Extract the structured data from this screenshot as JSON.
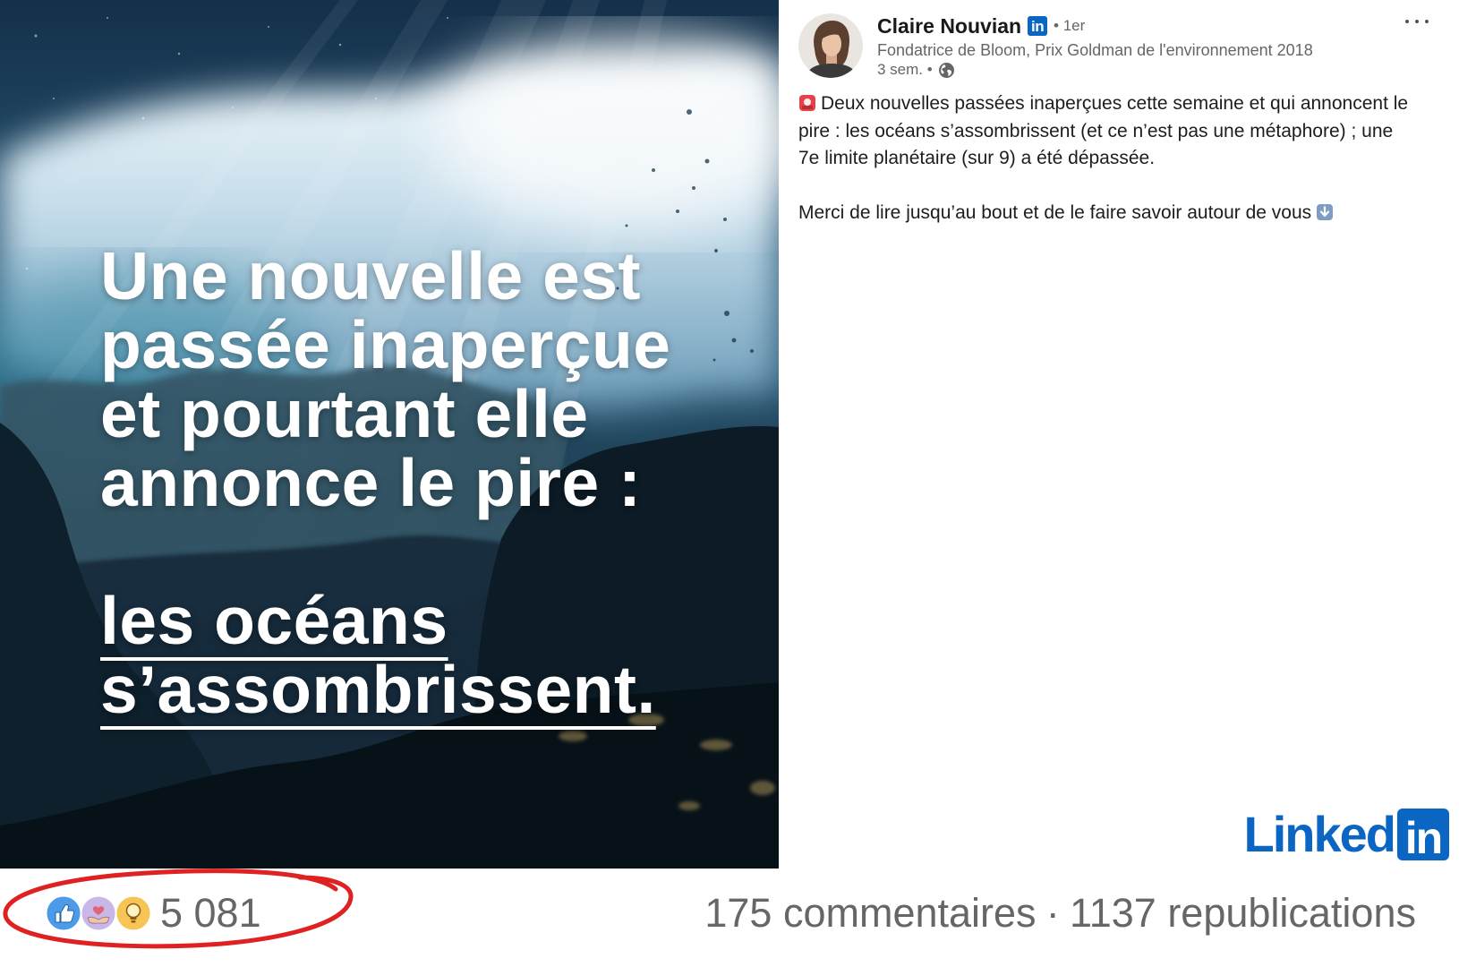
{
  "post_image": {
    "headline_lines": [
      "Une nouvelle est",
      "passée inaperçue",
      "et pourtant elle",
      "annonce le pire :"
    ],
    "highlight_lines": [
      "les océans",
      "s’assombrissent."
    ]
  },
  "author": {
    "avatar_icon": "author-avatar",
    "name": "Claire Nouvian",
    "badge_text": "in",
    "connection": "• 1er",
    "headline": "Fondatrice de Bloom, Prix Goldman de l'environnement 2018",
    "time": "3 sem. •",
    "visibility_icon": "globe-icon",
    "more_icon": "more-options-icon"
  },
  "post": {
    "lead_icon": "rotating-light-icon",
    "paragraph1_lines": [
      "Deux nouvelles passées inaperçues cette semaine et qui annoncent le",
      "pire : les océans s’assombrissent (et ce n’est pas une métaphore) ; une",
      "7e limite planétaire (sur 9) a été dépassée."
    ],
    "paragraph2": "Merci de lire jusqu’au bout et de le faire savoir autour de vous",
    "trail_icon": "down-arrow-icon"
  },
  "brand": {
    "word": "Linked",
    "box": "in"
  },
  "social": {
    "reaction_icons": [
      "like-icon",
      "support-icon",
      "insightful-icon"
    ],
    "reaction_count": "5 081",
    "comments": "175 commentaires",
    "separator": "·",
    "reposts": "1137 republications"
  },
  "colors": {
    "linkedin_blue": "#0a66c2",
    "meta_text": "#666666",
    "highlight_ring": "#e02121",
    "image_text": "#ffffff"
  }
}
